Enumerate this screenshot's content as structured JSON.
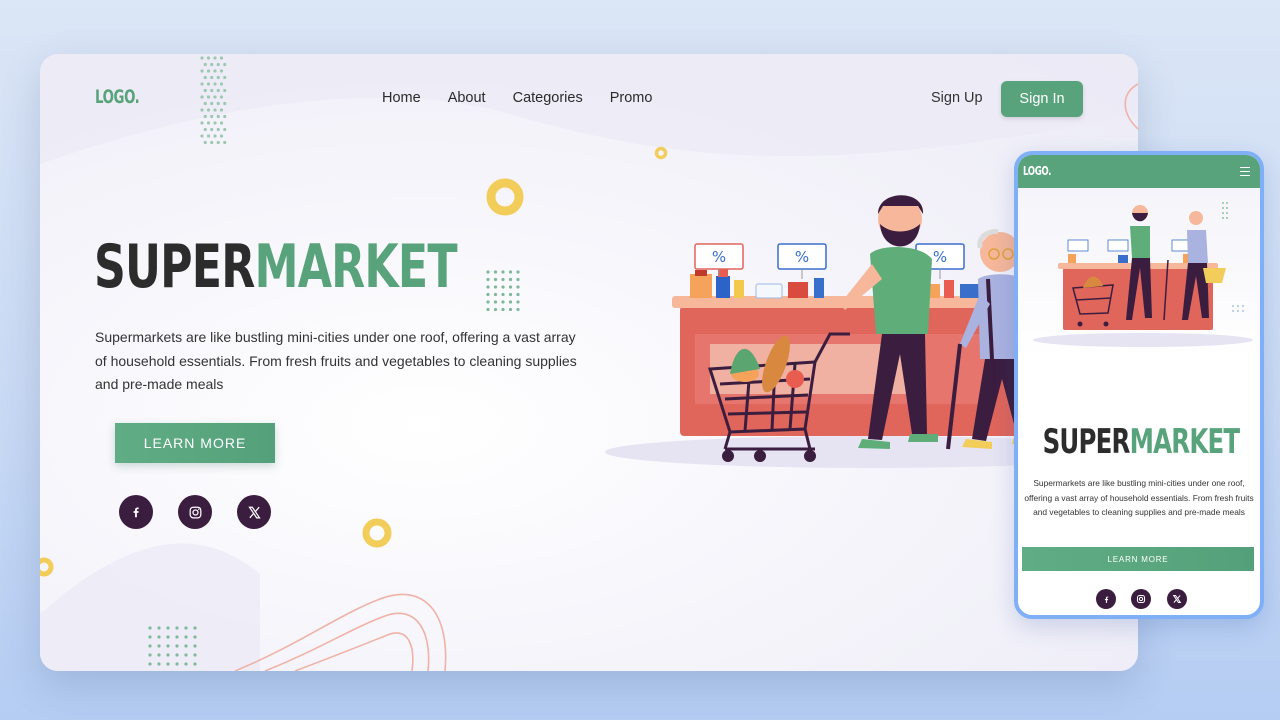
{
  "colors": {
    "accent": "#58a37b",
    "dark_purple": "#3b1d3f",
    "phone_frame": "#7fb0f7",
    "counter_red": "#e0655b"
  },
  "desktop": {
    "logo": "LOGO.",
    "nav": [
      "Home",
      "About",
      "Categories",
      "Promo"
    ],
    "sign_up": "Sign Up",
    "sign_in": "Sign In",
    "title_part1": "SUPER",
    "title_part2": "MARKET",
    "description": "Supermarkets are like bustling mini-cities under one roof, offering a vast array of household essentials. From fresh fruits and vegetables to cleaning supplies and pre-made meals",
    "learn_more": "LEARN MORE",
    "social_icons": [
      "facebook-icon",
      "instagram-icon",
      "x-icon"
    ],
    "discount_sign": "%"
  },
  "mobile": {
    "logo": "LOGO.",
    "menu_icon": "hamburger-icon",
    "title_part1": "SUPER",
    "title_part2": "MARKET",
    "description": "Supermarkets are like bustling mini-cities under one roof, offering a vast array of household essentials. From fresh fruits and vegetables to cleaning supplies and pre-made meals",
    "learn_more": "LEARN MORE",
    "social_icons": [
      "facebook-icon",
      "instagram-icon",
      "x-icon"
    ]
  }
}
